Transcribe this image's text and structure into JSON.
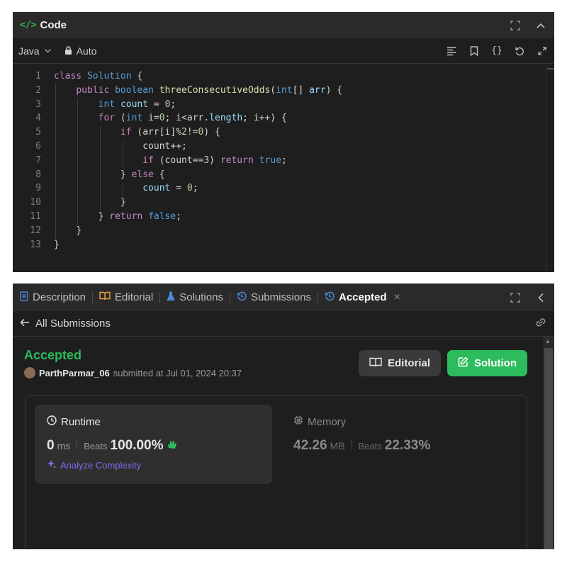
{
  "code_panel": {
    "title": "Code",
    "language": "Java",
    "mode": "Auto",
    "lines": [
      {
        "num": "1"
      },
      {
        "num": "2"
      },
      {
        "num": "3"
      },
      {
        "num": "4"
      },
      {
        "num": "5"
      },
      {
        "num": "6"
      },
      {
        "num": "7"
      },
      {
        "num": "8"
      },
      {
        "num": "9"
      },
      {
        "num": "10"
      },
      {
        "num": "11"
      },
      {
        "num": "12"
      },
      {
        "num": "13"
      }
    ],
    "code": {
      "l1_class": "class",
      "l1_name": "Solution",
      "l1_brace": " {",
      "l2_public": "public",
      "l2_boolean": "boolean",
      "l2_method": "threeConsecutiveOdds",
      "l2_int": "int",
      "l2_rest": "[] ",
      "l2_arr": "arr",
      "l2_end": ") {",
      "l3_int": "int",
      "l3_count": "count",
      "l3_eq": " = ",
      "l3_zero": "0",
      "l3_end": ";",
      "l4_for": "for",
      "l4_open": " (",
      "l4_int": "int",
      "l4_mid": " i=",
      "l4_zero": "0",
      "l4_cond": "; i<arr.",
      "l4_length": "length",
      "l4_end": "; i++) {",
      "l5_if": "if",
      "l5_expr": " (arr[i]%",
      "l5_two": "2",
      "l5_ne": "!=",
      "l5_zero": "0",
      "l5_end": ") {",
      "l6": "count++;",
      "l7_if": "if",
      "l7_expr": " (count==",
      "l7_three": "3",
      "l7_close": ") ",
      "l7_return": "return",
      "l7_true": "true",
      "l7_end": ";",
      "l8_close": "} ",
      "l8_else": "else",
      "l8_brace": " {",
      "l9_count": "count",
      "l9_eq": " = ",
      "l9_zero": "0",
      "l9_end": ";",
      "l10": "}",
      "l11_close": "} ",
      "l11_return": "return",
      "l11_false": "false",
      "l11_end": ";",
      "l12": "}",
      "l13": "}"
    }
  },
  "result_panel": {
    "tabs": [
      {
        "label": "Description"
      },
      {
        "label": "Editorial"
      },
      {
        "label": "Solutions"
      },
      {
        "label": "Submissions"
      },
      {
        "label": "Accepted"
      }
    ],
    "back_label": "All Submissions",
    "status": "Accepted",
    "username": "ParthParmar_06",
    "submitted_text": "submitted at Jul 01, 2024 20:37",
    "editorial_button": "Editorial",
    "solution_button": "Solution",
    "runtime": {
      "title": "Runtime",
      "value": "0",
      "unit": "ms",
      "beats_label": "Beats",
      "beats_value": "100.00%",
      "analyze": "Analyze Complexity"
    },
    "memory": {
      "title": "Memory",
      "value": "42.26",
      "unit": "MB",
      "beats_label": "Beats",
      "beats_value": "22.33%"
    }
  },
  "colors": {
    "accent_green": "#2cbb5d",
    "analyze_purple": "#7c6cf2",
    "panel_bg": "#1e1e1e"
  }
}
